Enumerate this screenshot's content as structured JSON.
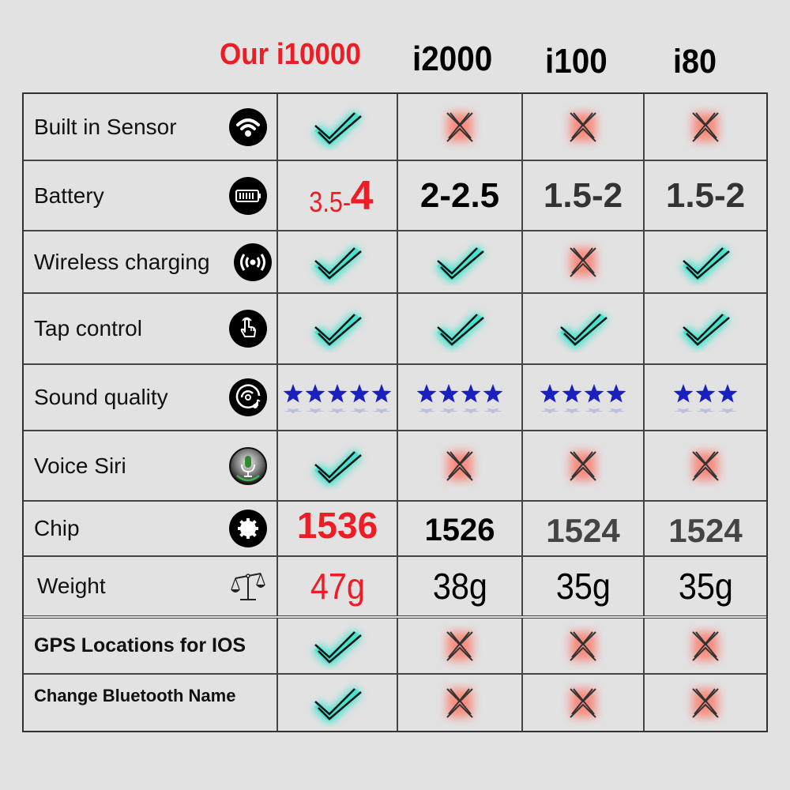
{
  "header": {
    "columns": [
      {
        "name": "Our i10000",
        "color": "#ee1c25"
      },
      {
        "name": "i2000",
        "color": "#000000"
      },
      {
        "name": "i100",
        "color": "#000000"
      },
      {
        "name": "i80",
        "color": "#000000"
      }
    ]
  },
  "colors": {
    "check_glow": "#3fe3cf",
    "cross_glow": "#f88a7e",
    "star": "#1a1fbf",
    "highlight": "#ee1c25"
  },
  "rows": [
    {
      "feature": "Built in Sensor",
      "icon": "wifi-icon",
      "values": [
        "check",
        "cross",
        "cross",
        "cross"
      ]
    },
    {
      "feature": "Battery",
      "icon": "battery-icon",
      "values": [
        "3.5-4",
        "2-2.5",
        "1.5-2",
        "1.5-2"
      ],
      "value_parts_first": [
        "3.5-",
        "4"
      ]
    },
    {
      "feature": "Wireless charging",
      "icon": "wireless-charging-icon",
      "values": [
        "check",
        "check",
        "cross",
        "check"
      ]
    },
    {
      "feature": "Tap control",
      "icon": "tap-hand-icon",
      "values": [
        "check",
        "check",
        "check",
        "check"
      ]
    },
    {
      "feature": "Sound quality",
      "icon": "music-disc-icon",
      "values": [
        "5 stars",
        "4 stars",
        "4 stars",
        "3 stars"
      ],
      "stars": [
        5,
        4,
        4,
        3
      ],
      "stars_max": 5
    },
    {
      "feature": "Voice Siri",
      "icon": "microphone-icon",
      "values": [
        "check",
        "cross",
        "cross",
        "cross"
      ]
    },
    {
      "feature": "Chip",
      "icon": "chip-icon",
      "values": [
        "1536",
        "1526",
        "1524",
        "1524"
      ]
    },
    {
      "feature": "Weight",
      "icon": "scale-icon",
      "values": [
        "47g",
        "38g",
        "35g",
        "35g"
      ]
    },
    {
      "feature": "GPS Locations for IOS",
      "icon": null,
      "values": [
        "check",
        "cross",
        "cross",
        "cross"
      ]
    },
    {
      "feature": "Change Bluetooth Name",
      "icon": null,
      "values": [
        "check",
        "cross",
        "cross",
        "cross"
      ]
    }
  ]
}
